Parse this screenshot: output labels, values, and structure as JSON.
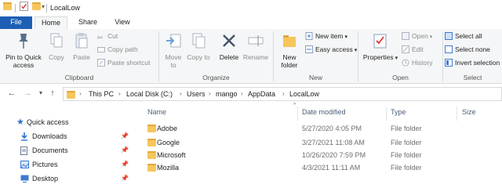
{
  "window": {
    "title": "LocalLow"
  },
  "ribbon_tabs": [
    "File",
    "Home",
    "Share",
    "View"
  ],
  "ribbon": {
    "clipboard": {
      "label": "Clipboard",
      "pin": "Pin to Quick access",
      "copy": "Copy",
      "paste": "Paste",
      "cut": "Cut",
      "copy_path": "Copy path",
      "paste_shortcut": "Paste shortcut"
    },
    "organize": {
      "label": "Organize",
      "move_to": "Move to",
      "copy_to": "Copy to",
      "delete": "Delete",
      "rename": "Rename"
    },
    "new": {
      "label": "New",
      "new_folder": "New folder",
      "new_item": "New item",
      "easy_access": "Easy access"
    },
    "open": {
      "label": "Open",
      "properties": "Properties",
      "open": "Open",
      "edit": "Edit",
      "history": "History"
    },
    "select": {
      "label": "Select",
      "select_all": "Select all",
      "select_none": "Select none",
      "invert_selection": "Invert selection"
    }
  },
  "address": {
    "breadcrumbs": [
      "This PC",
      "Local Disk (C:)",
      "Users",
      "mango",
      "AppData",
      "LocalLow"
    ]
  },
  "nav_pane": [
    {
      "label": "Quick access",
      "icon": "star-icon",
      "pinned": false
    },
    {
      "label": "Downloads",
      "icon": "download-arrow-icon",
      "pinned": true
    },
    {
      "label": "Documents",
      "icon": "document-icon",
      "pinned": true
    },
    {
      "label": "Pictures",
      "icon": "picture-icon",
      "pinned": true
    },
    {
      "label": "Desktop",
      "icon": "desktop-icon",
      "pinned": true
    }
  ],
  "columns": {
    "name": "Name",
    "date": "Date modified",
    "type": "Type",
    "size": "Size"
  },
  "files": [
    {
      "name": "Adobe",
      "date": "5/27/2020 4:05 PM",
      "type": "File folder"
    },
    {
      "name": "Google",
      "date": "3/27/2021 11:08 AM",
      "type": "File folder"
    },
    {
      "name": "Microsoft",
      "date": "10/26/2020 7:59 PM",
      "type": "File folder"
    },
    {
      "name": "Mozilla",
      "date": "4/3/2021 11:11 AM",
      "type": "File folder"
    }
  ],
  "colors": {
    "accent": "#1e5fb4",
    "folder": "#f5c65b",
    "header_text": "#4c607a"
  }
}
